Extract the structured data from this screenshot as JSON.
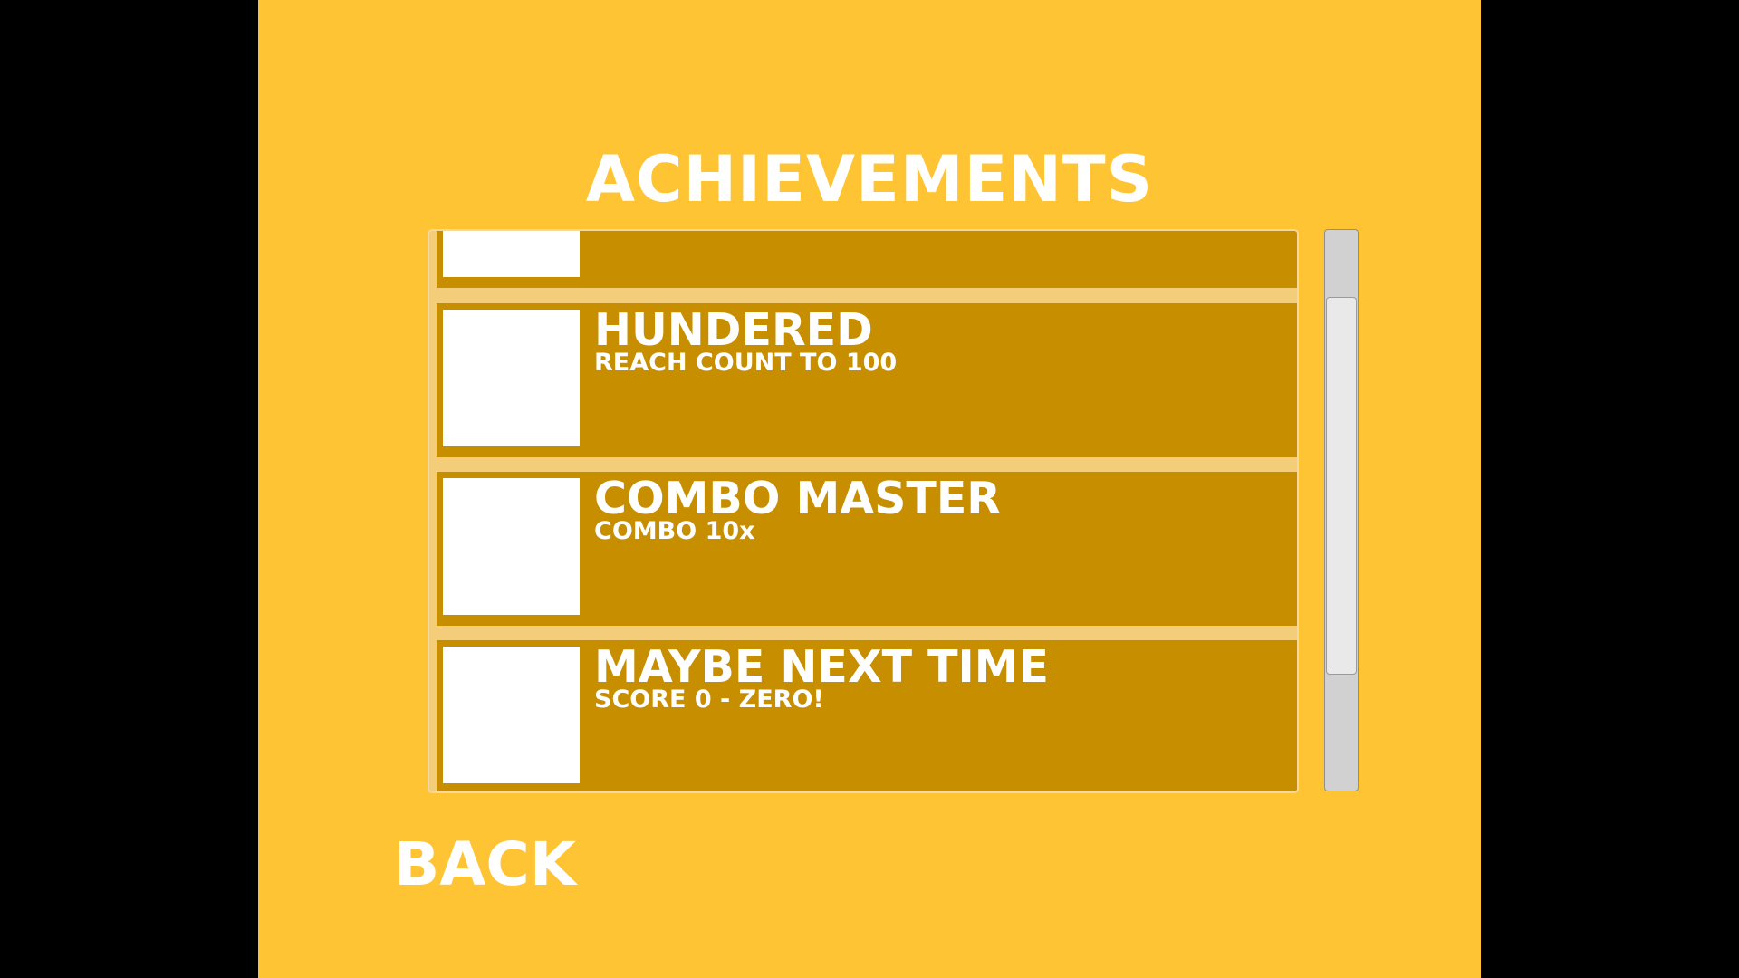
{
  "screen": {
    "title": "ACHIEVEMENTS",
    "back_label": "BACK"
  },
  "colors": {
    "background": "#FEC433",
    "row": "#C78F00",
    "text": "#FFFFFF",
    "letterbox": "#000000"
  },
  "achievements": [
    {
      "title": "",
      "description": ""
    },
    {
      "title": "HUNDERED",
      "description": "REACH COUNT TO 100"
    },
    {
      "title": "COMBO MASTER",
      "description": "COMBO 10x"
    },
    {
      "title": "MAYBE NEXT TIME",
      "description": "SCORE 0 - ZERO!"
    }
  ]
}
